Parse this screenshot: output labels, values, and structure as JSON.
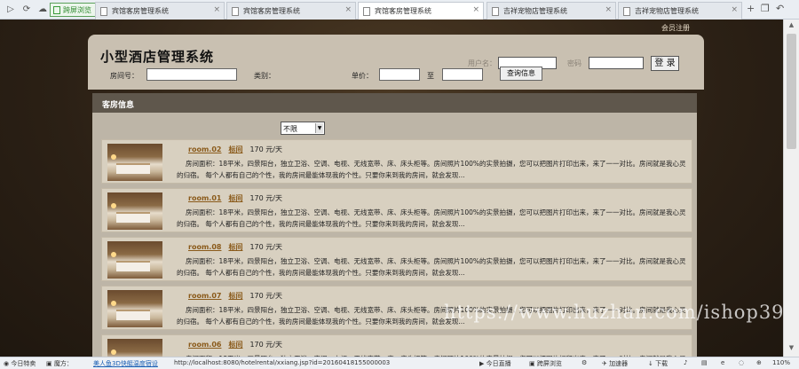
{
  "browser": {
    "tabs": [
      {
        "label": "宾馆客房管理系统",
        "active": false
      },
      {
        "label": "宾馆客房管理系统",
        "active": false
      },
      {
        "label": "宾馆客房管理系统",
        "active": true
      },
      {
        "label": "吉祥宠物店管理系统",
        "active": false
      },
      {
        "label": "吉祥宠物店管理系统",
        "active": false
      }
    ],
    "green_tab_label": "跨屏浏览"
  },
  "header": {
    "member_register": "会员注册",
    "site_title": "小型酒店管理系统",
    "username_label": "用户名：",
    "password_label": "密码",
    "login_button": "登 录"
  },
  "section": {
    "title": "客房信息"
  },
  "search": {
    "room_label": "房间号：",
    "type_label": "类别：",
    "type_selected": "不限",
    "price_label": "单价：",
    "to_label": "至",
    "button": "查询信息"
  },
  "rooms": [
    {
      "number": "room.02",
      "type": "标间",
      "price": "170 元/天"
    },
    {
      "number": "room.01",
      "type": "标间",
      "price": "170 元/天"
    },
    {
      "number": "room.08",
      "type": "标间",
      "price": "170 元/天"
    },
    {
      "number": "room.07",
      "type": "标间",
      "price": "170 元/天"
    },
    {
      "number": "room.06",
      "type": "标间",
      "price": "170 元/天"
    }
  ],
  "room_description": "房间面积：18平米，四景阳台，独立卫浴、空调、电视、无线宽带、床、床头柜等。房间照片100%的实景拍摄，您可以把图片打印出来，来了一一对比。房间就是我心灵的归宿。 每个人都有自己的个性，我的房间最能体现我的个性。只要你来到我的房间，就会发现...",
  "watermark": "https://www.huzhan.com/ishop39397",
  "statusbar": {
    "today_focus": "今日特卖",
    "magic": "魔方：",
    "promo_link": "美人鱼3D快艇温度宿设",
    "url": "http://localhost:8080/hotelrental/xxiang.jsp?id=20160418155000003",
    "live": "今日直播",
    "cross_screen": "跨屏浏览",
    "accelerator": "加速器",
    "download": "下载",
    "zoom": "110%"
  }
}
